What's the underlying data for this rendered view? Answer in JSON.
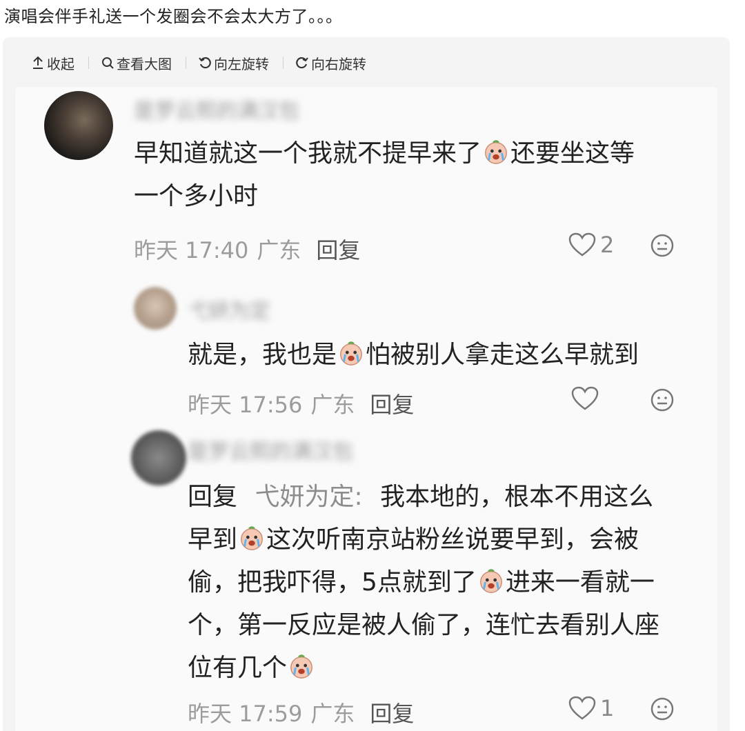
{
  "post": {
    "title": "演唱会伴手礼送一个发圈会不会太大方了。。。"
  },
  "toolbar": {
    "collapse_label": "收起",
    "view_large_label": "查看大图",
    "rotate_left_label": "向左旋转",
    "rotate_right_label": "向右旋转"
  },
  "comments": [
    {
      "username": "是罗云熙的满汉包",
      "line1_a": "早知道就这一个我就不提早来了",
      "line1_b": "还要坐这等",
      "line2": "一个多小时",
      "time": "昨天 17:40",
      "location": "广东",
      "reply_label": "回复",
      "likes": "2"
    },
    {
      "username": "弋妍为定",
      "line1_a": "就是，我也是",
      "line1_b": "怕被别人拿走这么早就到",
      "time": "昨天 17:56",
      "location": "广东",
      "reply_label": "回复",
      "likes": ""
    },
    {
      "username": "是罗云熙的满汉包",
      "reply_prefix": "回复",
      "reply_to": "弋妍为定",
      "line1_rest": "我本地的，根本不用这么",
      "line2_a": "早到",
      "line2_b": "这次听南京站粉丝说要早到，会被",
      "line3_a": "偷，把我吓得，5点就到了",
      "line3_b": "进来一看就一",
      "line4": "个，第一反应是被人偷了，连忙去看别人座",
      "line5": "位有几个",
      "time": "昨天 17:59",
      "location": "广东",
      "reply_label": "回复",
      "likes": "1"
    }
  ]
}
